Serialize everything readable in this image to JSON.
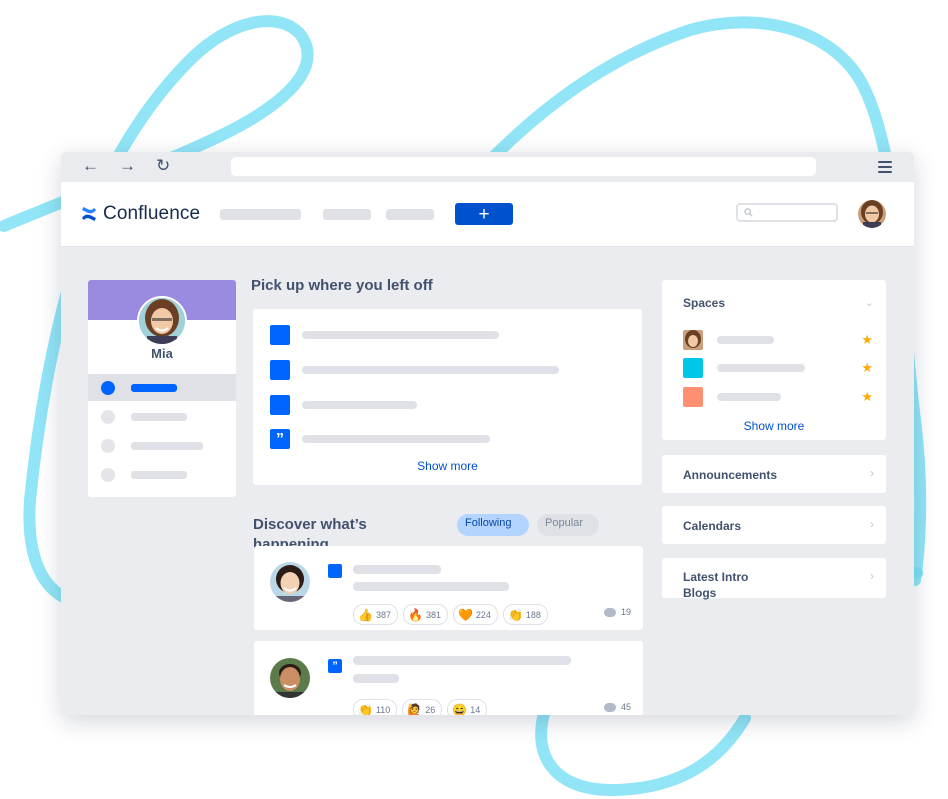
{
  "browser": {
    "back_icon": "←",
    "forward_icon": "→",
    "reload_icon": "↻"
  },
  "header": {
    "logo_text": "Confluence",
    "create_label": "+"
  },
  "profile": {
    "name": "Mia"
  },
  "recent": {
    "title": "Pick up where you left off",
    "quote_icon": "”",
    "show_more": "Show more"
  },
  "discover": {
    "title": "Discover what’s happening",
    "tabs": {
      "following": "Following",
      "popular": "Popular"
    },
    "posts": [
      {
        "icon": "",
        "reactions": [
          {
            "emoji": "👍",
            "count": "387"
          },
          {
            "emoji": "🔥",
            "count": "381"
          },
          {
            "emoji": "🧡",
            "count": "224"
          },
          {
            "emoji": "👏",
            "count": "188"
          }
        ],
        "comments": "19"
      },
      {
        "icon": "”",
        "reactions": [
          {
            "emoji": "👏",
            "count": "110"
          },
          {
            "emoji": "🙋",
            "count": "26"
          },
          {
            "emoji": "😄",
            "count": "14"
          }
        ],
        "comments": "45"
      }
    ]
  },
  "sidebar_right": {
    "spaces_title": "Spaces",
    "spaces_show_more": "Show more",
    "star_icon": "★",
    "chevron_down": "⌄",
    "chevron_right": "›",
    "announcements": "Announcements",
    "calendars": "Calendars",
    "latest_intro": "Latest Intro Blogs"
  },
  "colors": {
    "brand": "#0052CC",
    "accent": "#0065FF",
    "profile_band": "#9A8BE0",
    "space_teal": "#00C7E6",
    "space_orange": "#FF8F73",
    "star": "#FFAB00",
    "deco_line": "#79E2F2"
  }
}
